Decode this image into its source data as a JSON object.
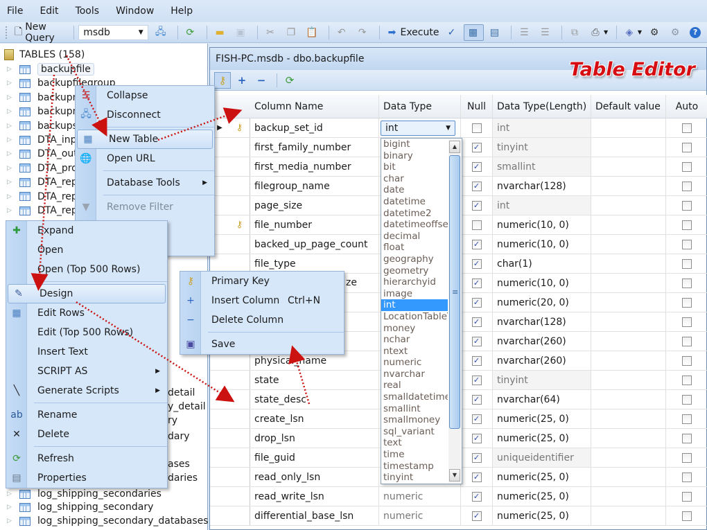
{
  "menubar": [
    "File",
    "Edit",
    "Tools",
    "Window",
    "Help"
  ],
  "toolbar": {
    "new_query": "New Query",
    "database": "msdb",
    "execute": "Execute"
  },
  "tree": {
    "root": "TABLES (158)",
    "items": [
      "backupfile",
      "backupfilegroup",
      "backupm",
      "backupm",
      "backups",
      "DTA_inpu",
      "DTA_out",
      "DTA_pro",
      "DTA_rep",
      "DTA_rep",
      "DTA_rep"
    ],
    "partial_right": [
      "detail",
      "y_detail",
      "ry",
      "dary",
      "ases",
      "daries"
    ],
    "bottom_items": [
      "log_shipping_secondaries",
      "log_shipping_secondary",
      "log_shipping_secondary_databases"
    ]
  },
  "editor": {
    "title": "FISH-PC.msdb - dbo.backupfile",
    "logo": "Table Editor",
    "columns": [
      "Column Name",
      "Data Type",
      "Null",
      "Data Type(Length)",
      "Default value",
      "Auto"
    ],
    "rows": [
      {
        "name": "backup_set_id",
        "type": "int",
        "null": false,
        "length": "int",
        "key": true,
        "current": true,
        "dim": true
      },
      {
        "name": "first_family_number",
        "type": "",
        "null": true,
        "length": "tinyint",
        "dim": true
      },
      {
        "name": "first_media_number",
        "type": "",
        "null": true,
        "length": "smallint",
        "dim": true
      },
      {
        "name": "filegroup_name",
        "type": "",
        "null": true,
        "length": "nvarchar(128)"
      },
      {
        "name": "page_size",
        "type": "",
        "null": true,
        "length": "int",
        "dim": true
      },
      {
        "name": "file_number",
        "type": "",
        "null": false,
        "length": "numeric(10, 0)",
        "key": true
      },
      {
        "name": "backed_up_page_count",
        "type": "",
        "null": true,
        "length": "numeric(10, 0)"
      },
      {
        "name": "file_type",
        "type": "",
        "null": true,
        "length": "char(1)"
      },
      {
        "name": "",
        "type": "",
        "null": true,
        "length": "numeric(10, 0)"
      },
      {
        "name": "",
        "type": "",
        "null": true,
        "length": "numeric(20, 0)"
      },
      {
        "name": "",
        "type": "",
        "null": true,
        "length": "nvarchar(128)"
      },
      {
        "name": "",
        "type": "",
        "null": true,
        "length": "nvarchar(260)"
      },
      {
        "name": "physical_name",
        "type": "",
        "null": true,
        "length": "nvarchar(260)"
      },
      {
        "name": "state",
        "type": "",
        "null": true,
        "length": "tinyint",
        "dim": true
      },
      {
        "name": "state_desc",
        "type": "",
        "null": true,
        "length": "nvarchar(64)"
      },
      {
        "name": "create_lsn",
        "type": "",
        "null": true,
        "length": "numeric(25, 0)"
      },
      {
        "name": "drop_lsn",
        "type": "",
        "null": true,
        "length": "numeric(25, 0)"
      },
      {
        "name": "file_guid",
        "type": "",
        "null": true,
        "length": "uniqueidentifier",
        "dim": true
      },
      {
        "name": "read_only_lsn",
        "type": "",
        "null": true,
        "length": "numeric(25, 0)"
      },
      {
        "name": "read_write_lsn",
        "type": "numeric",
        "null": true,
        "length": "numeric(25, 0)"
      },
      {
        "name": "differential_base_lsn",
        "type": "numeric",
        "null": true,
        "length": "numeric(25, 0)"
      }
    ],
    "partial_name_under_menu": "ze"
  },
  "type_dropdown": {
    "selected": "int",
    "options": [
      "bigint",
      "binary",
      "bit",
      "char",
      "date",
      "datetime",
      "datetime2",
      "datetimeoffset",
      "decimal",
      "float",
      "geography",
      "geometry",
      "hierarchyid",
      "image",
      "int",
      "LocationTableType",
      "money",
      "nchar",
      "ntext",
      "numeric",
      "nvarchar",
      "real",
      "smalldatetime",
      "smallint",
      "smallmoney",
      "sql_variant",
      "text",
      "time",
      "timestamp",
      "tinyint"
    ]
  },
  "menu_server": {
    "items": [
      {
        "icon": "collapse-icon",
        "label": "Collapse"
      },
      {
        "icon": "disconnect-icon",
        "label": "Disconnect"
      },
      {
        "sep": true
      },
      {
        "icon": "new-table-icon",
        "label": "New Table",
        "highlight": true
      },
      {
        "icon": "open-url-icon",
        "label": "Open URL"
      },
      {
        "sep": true
      },
      {
        "icon": "",
        "label": "Database Tools",
        "submenu": true
      },
      {
        "sep": true
      },
      {
        "icon": "filter-icon",
        "label": "Remove Filter",
        "disabled": true
      },
      {
        "icon": "refresh-icon",
        "label": "Refresh"
      },
      {
        "icon": "properties-icon",
        "label": "Properties"
      }
    ]
  },
  "menu_table": {
    "items": [
      {
        "icon": "expand-icon",
        "label": "Expand"
      },
      {
        "icon": "",
        "label": "Open"
      },
      {
        "icon": "",
        "label": "Open (Top 500 Rows)"
      },
      {
        "sep": true
      },
      {
        "icon": "design-icon",
        "label": "Design",
        "highlight": true
      },
      {
        "icon": "edit-rows-icon",
        "label": "Edit Rows"
      },
      {
        "icon": "",
        "label": "Edit (Top 500 Rows)"
      },
      {
        "icon": "",
        "label": "Insert Text"
      },
      {
        "icon": "",
        "label": "SCRIPT AS",
        "submenu": true
      },
      {
        "icon": "generate-scripts-icon",
        "label": "Generate Scripts",
        "submenu": true
      },
      {
        "sep": true
      },
      {
        "icon": "rename-icon",
        "label": "Rename"
      },
      {
        "icon": "delete-icon",
        "label": "Delete"
      },
      {
        "sep": true
      },
      {
        "icon": "refresh-icon",
        "label": "Refresh"
      },
      {
        "icon": "properties-icon",
        "label": "Properties"
      }
    ]
  },
  "menu_column": {
    "items": [
      {
        "icon": "key-icon",
        "label": "Primary Key",
        "shortcut": ""
      },
      {
        "icon": "plus-icon",
        "label": "Insert Column",
        "shortcut": "Ctrl+N"
      },
      {
        "icon": "minus-icon",
        "label": "Delete Column",
        "shortcut": ""
      },
      {
        "sep": true
      },
      {
        "icon": "save-icon",
        "label": "Save",
        "shortcut": ""
      }
    ]
  },
  "colors": {
    "annotation_arrow": "#cc1111",
    "selection": "#3399ff",
    "logo": "#d60d12"
  }
}
